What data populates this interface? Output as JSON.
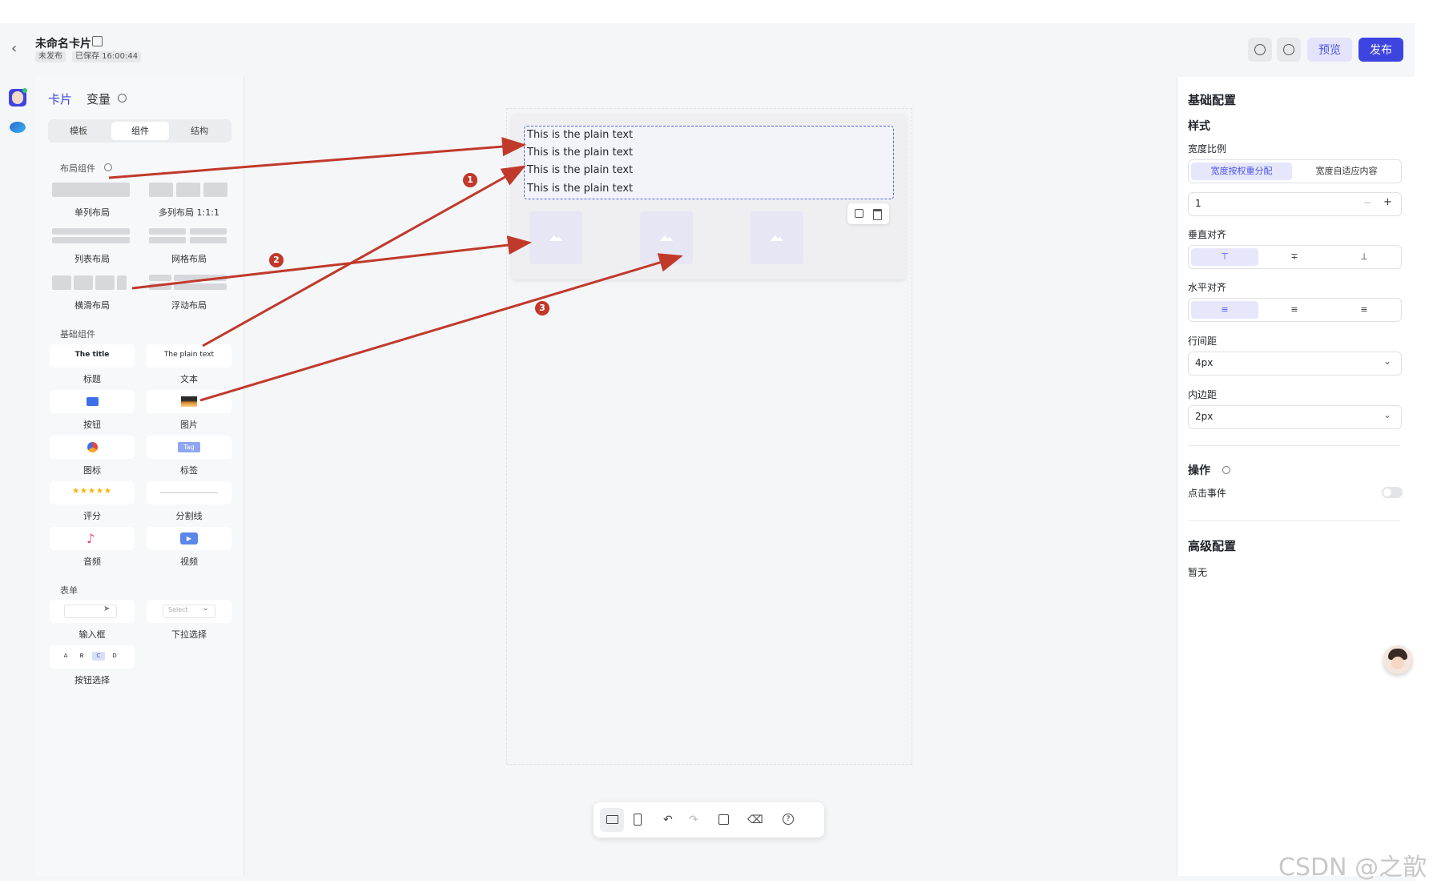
{
  "header": {
    "title": "未命名卡片",
    "status_badge": "未发布",
    "saved_badge": "已保存 16:00:44",
    "preview_label": "预览",
    "publish_label": "发布"
  },
  "panel": {
    "tabs": [
      "卡片",
      "变量"
    ],
    "segments": [
      "模板",
      "组件",
      "结构"
    ],
    "layout_section": "布局组件",
    "layout_items": [
      "单列布局",
      "多列布局 1:1:1",
      "列表布局",
      "网格布局",
      "横滑布局",
      "浮动布局"
    ],
    "basic_section": "基础组件",
    "basic_items": [
      "标题",
      "文本",
      "按钮",
      "图片",
      "图标",
      "标签",
      "评分",
      "分割线",
      "音频",
      "视频"
    ],
    "title_preview": "The title",
    "text_preview": "The plain text",
    "tag_preview": "Tag",
    "form_section": "表单",
    "form_items": [
      "输入框",
      "下拉选择",
      "按钮选择"
    ],
    "select_placeholder": "Select",
    "choice_options": [
      "A",
      "B",
      "C",
      "D"
    ]
  },
  "canvas": {
    "text_lines": [
      "This is the plain text",
      "This is the plain text",
      "This is the plain text",
      "This is the plain text"
    ],
    "annotations": [
      "1",
      "2",
      "3"
    ]
  },
  "rpanel": {
    "basic_title": "基础配置",
    "style_title": "样式",
    "width_ratio_label": "宽度比例",
    "width_options": [
      "宽度按权重分配",
      "宽度自适应内容"
    ],
    "weight_value": "1",
    "valign_label": "垂直对齐",
    "halign_label": "水平对齐",
    "line_spacing_label": "行间距",
    "line_spacing_value": "4px",
    "padding_label": "内边距",
    "padding_value": "2px",
    "action_title": "操作",
    "click_event_label": "点击事件",
    "advanced_title": "高级配置",
    "advanced_value": "暂无"
  },
  "watermark": "CSDN @之歆",
  "colors": {
    "accent": "#4b52e8",
    "annotation": "#c0392b",
    "selected_bg": "#e6e7fb"
  }
}
